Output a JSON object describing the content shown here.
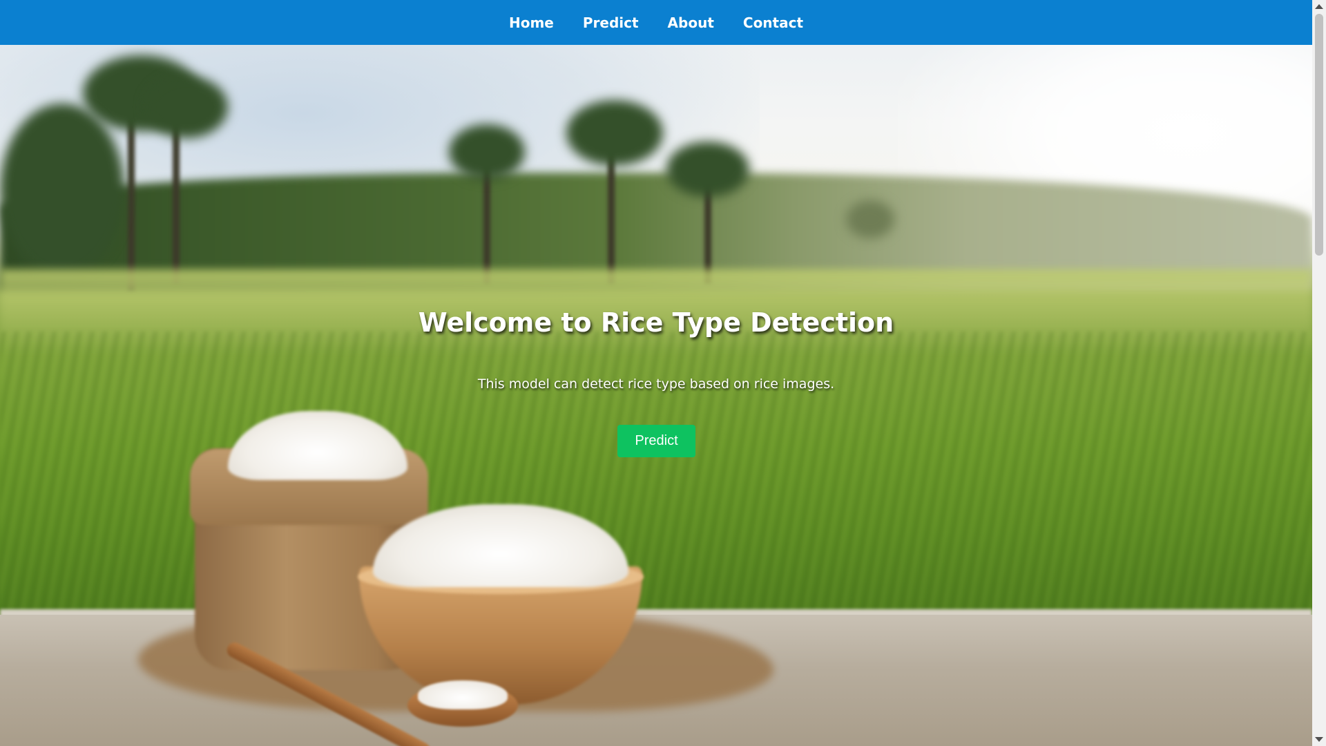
{
  "nav": {
    "items": [
      {
        "label": "Home"
      },
      {
        "label": "Predict"
      },
      {
        "label": "About"
      },
      {
        "label": "Contact"
      }
    ]
  },
  "hero": {
    "title": "Welcome to Rice Type Detection",
    "subtitle": "This model can detect rice type based on rice images.",
    "button_label": "Predict",
    "background_image": "rice-field-photo"
  },
  "colors": {
    "nav_background": "#0b80d0",
    "button_background": "#0ec260",
    "text": "#ffffff"
  }
}
